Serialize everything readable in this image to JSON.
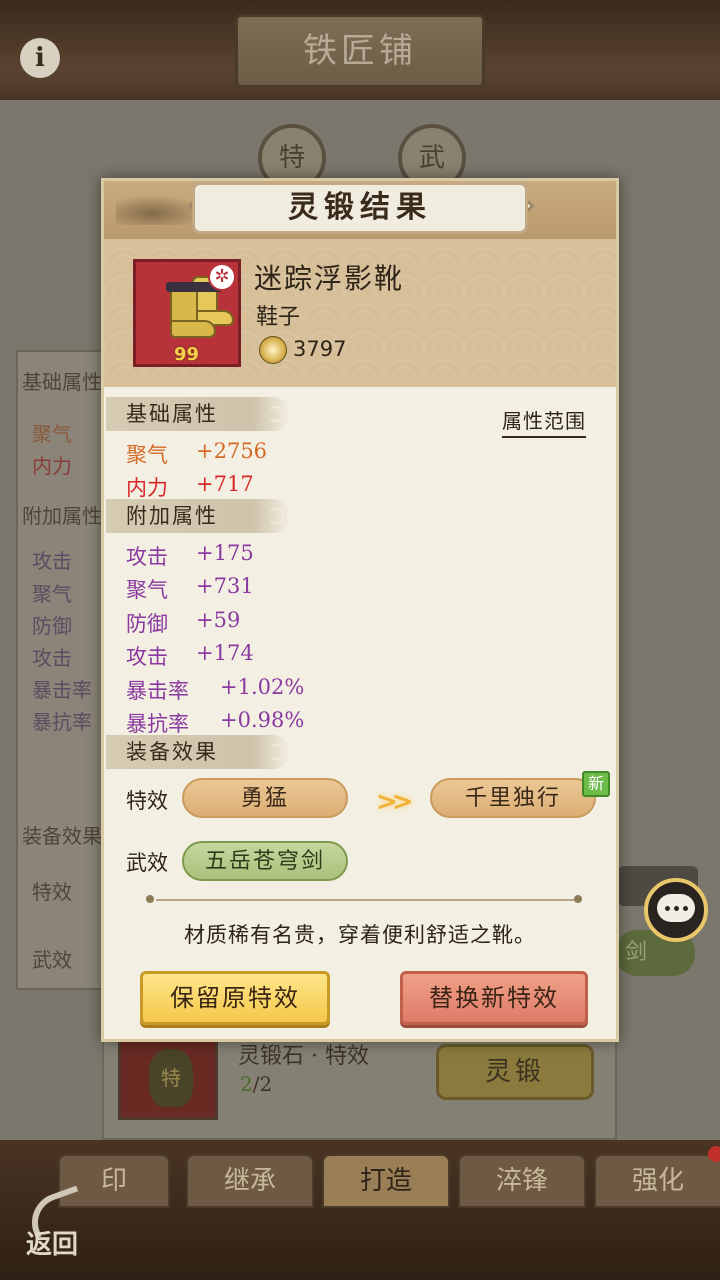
{
  "background": {
    "title": "铁匠铺",
    "info_icon": "i",
    "circles": [
      "特",
      "武"
    ],
    "left_panel": {
      "base_header": "基础属性",
      "base_stats": [
        "聚气",
        "内力"
      ],
      "extra_header": "附加属性",
      "extra_stats": [
        "攻击",
        "聚气",
        "防御",
        "攻击",
        "暴击率",
        "暴抗率"
      ],
      "equip_header": "装备效果",
      "effect_labels": [
        "特效",
        "武效"
      ]
    },
    "right_pill_text": "剑",
    "stone": {
      "name": "灵锻石 · 特效",
      "have": "2",
      "need": "/2",
      "stone_char": "特",
      "forge_button": "灵锻"
    },
    "tabs": [
      "印",
      "继承",
      "打造",
      "淬锋",
      "强化"
    ],
    "active_tab": "打造",
    "back_label": "返回"
  },
  "dialog": {
    "title": "灵锻结果",
    "item": {
      "name": "迷踪浮影靴",
      "type": "鞋子",
      "level": "99",
      "quality_icon": "✲",
      "power": "3797"
    },
    "base_section": "基础属性",
    "attr_range_link": "属性范围",
    "base_stats": [
      {
        "key": "聚气",
        "value": "+2756"
      },
      {
        "key": "内力",
        "value": "+717"
      }
    ],
    "extra_section": "附加属性",
    "extra_stats": [
      {
        "key": "攻击",
        "value": "+175"
      },
      {
        "key": "聚气",
        "value": "+731"
      },
      {
        "key": "防御",
        "value": "+59"
      },
      {
        "key": "攻击",
        "value": "+174"
      },
      {
        "key": "暴击率",
        "value": "+1.02%"
      },
      {
        "key": "暴抗率",
        "value": "+0.98%"
      }
    ],
    "equip_section": "装备效果",
    "special_label": "特效",
    "special_old": "勇猛",
    "special_arrow": ">>",
    "special_new": "千里独行",
    "new_badge": "新",
    "weapon_label": "武效",
    "weapon_effect": "五岳苍穹剑",
    "description": "材质稀有名贵，穿着便利舒适之靴。",
    "keep_button": "保留原特效",
    "replace_button": "替换新特效"
  },
  "colors": {
    "stat_orange": "#d46a28",
    "stat_red": "#d82828",
    "stat_purple": "#8a3aa0",
    "keep_button": "#f3c94a",
    "replace_button": "#de7b68"
  }
}
